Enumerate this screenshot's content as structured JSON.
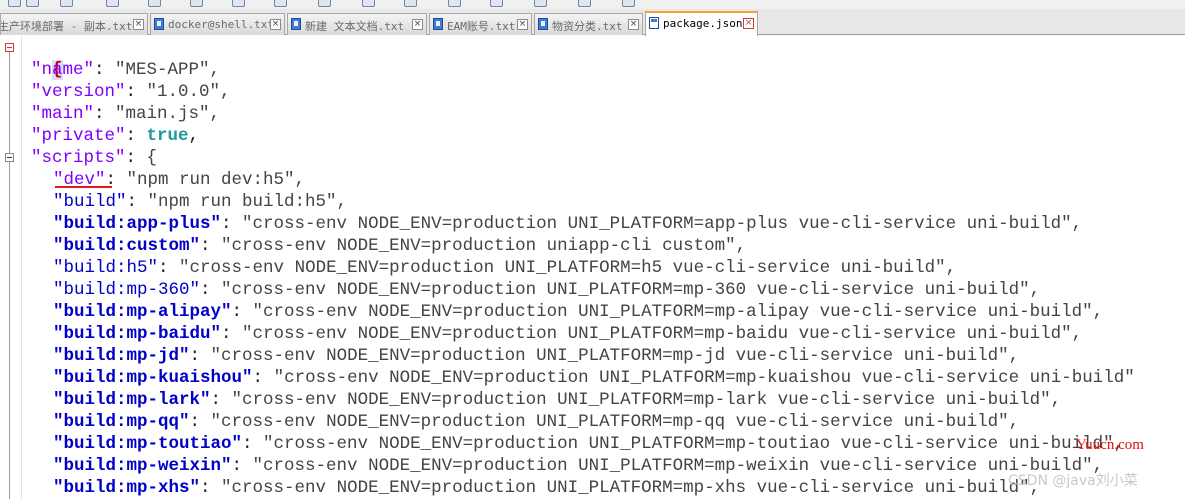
{
  "tabs": [
    {
      "label": "生产环境部署 - 副本.txt",
      "active": false
    },
    {
      "label": "docker@shell.txt",
      "active": false
    },
    {
      "label": "新建 文本文档.txt",
      "active": false
    },
    {
      "label": "EAM账号.txt",
      "active": false
    },
    {
      "label": "物资分类.txt",
      "active": false
    },
    {
      "label": "package.json",
      "active": true
    }
  ],
  "editor": {
    "open_brace": "{",
    "fields": [
      {
        "key": "\"name\"",
        "value": "\"MES-APP\","
      },
      {
        "key": "\"version\"",
        "value": "\"1.0.0\","
      },
      {
        "key": "\"main\"",
        "value": "\"main.js\","
      },
      {
        "key": "\"private\"",
        "value": "true"
      },
      {
        "key": "\"scripts\"",
        "value": "{"
      }
    ],
    "scripts": [
      {
        "key": "\"dev\"",
        "value": "\"npm run dev:h5\","
      },
      {
        "key": "\"build\"",
        "value": "\"npm run build:h5\","
      },
      {
        "key": "\"build:app-plus\"",
        "value": "\"cross-env NODE_ENV=production UNI_PLATFORM=app-plus vue-cli-service uni-build\","
      },
      {
        "key": "\"build:custom\"",
        "value": "\"cross-env NODE_ENV=production uniapp-cli custom\","
      },
      {
        "key": "\"build:h5\"",
        "value": "\"cross-env NODE_ENV=production UNI_PLATFORM=h5 vue-cli-service uni-build\","
      },
      {
        "key": "\"build:mp-360\"",
        "value": "\"cross-env NODE_ENV=production UNI_PLATFORM=mp-360 vue-cli-service uni-build\","
      },
      {
        "key": "\"build:mp-alipay\"",
        "value": "\"cross-env NODE_ENV=production UNI_PLATFORM=mp-alipay vue-cli-service uni-build\","
      },
      {
        "key": "\"build:mp-baidu\"",
        "value": "\"cross-env NODE_ENV=production UNI_PLATFORM=mp-baidu vue-cli-service uni-build\","
      },
      {
        "key": "\"build:mp-jd\"",
        "value": "\"cross-env NODE_ENV=production UNI_PLATFORM=mp-jd vue-cli-service uni-build\","
      },
      {
        "key": "\"build:mp-kuaishou\"",
        "value": "\"cross-env NODE_ENV=production UNI_PLATFORM=mp-kuaishou vue-cli-service uni-build\""
      },
      {
        "key": "\"build:mp-lark\"",
        "value": "\"cross-env NODE_ENV=production UNI_PLATFORM=mp-lark vue-cli-service uni-build\","
      },
      {
        "key": "\"build:mp-qq\"",
        "value": "\"cross-env NODE_ENV=production UNI_PLATFORM=mp-qq vue-cli-service uni-build\","
      },
      {
        "key": "\"build:mp-toutiao\"",
        "value": "\"cross-env NODE_ENV=production UNI_PLATFORM=mp-toutiao vue-cli-service uni-build\","
      },
      {
        "key": "\"build:mp-weixin\"",
        "value": "\"cross-env NODE_ENV=production UNI_PLATFORM=mp-weixin vue-cli-service uni-build\","
      },
      {
        "key": "\"build:mp-xhs\"",
        "value": "\"cross-env NODE_ENV=production UNI_PLATFORM=mp-xhs vue-cli-service uni-build\","
      }
    ]
  },
  "overlay_text": "Yuucn.com",
  "watermark": "CSDN @java刘小菜",
  "colors": {
    "active_tab_accent": "#f6a431",
    "key_purple": "#8000ff",
    "key_blue": "#0000c8",
    "boolean": "#1a9b9b",
    "annotation_red": "#e11b1b"
  }
}
